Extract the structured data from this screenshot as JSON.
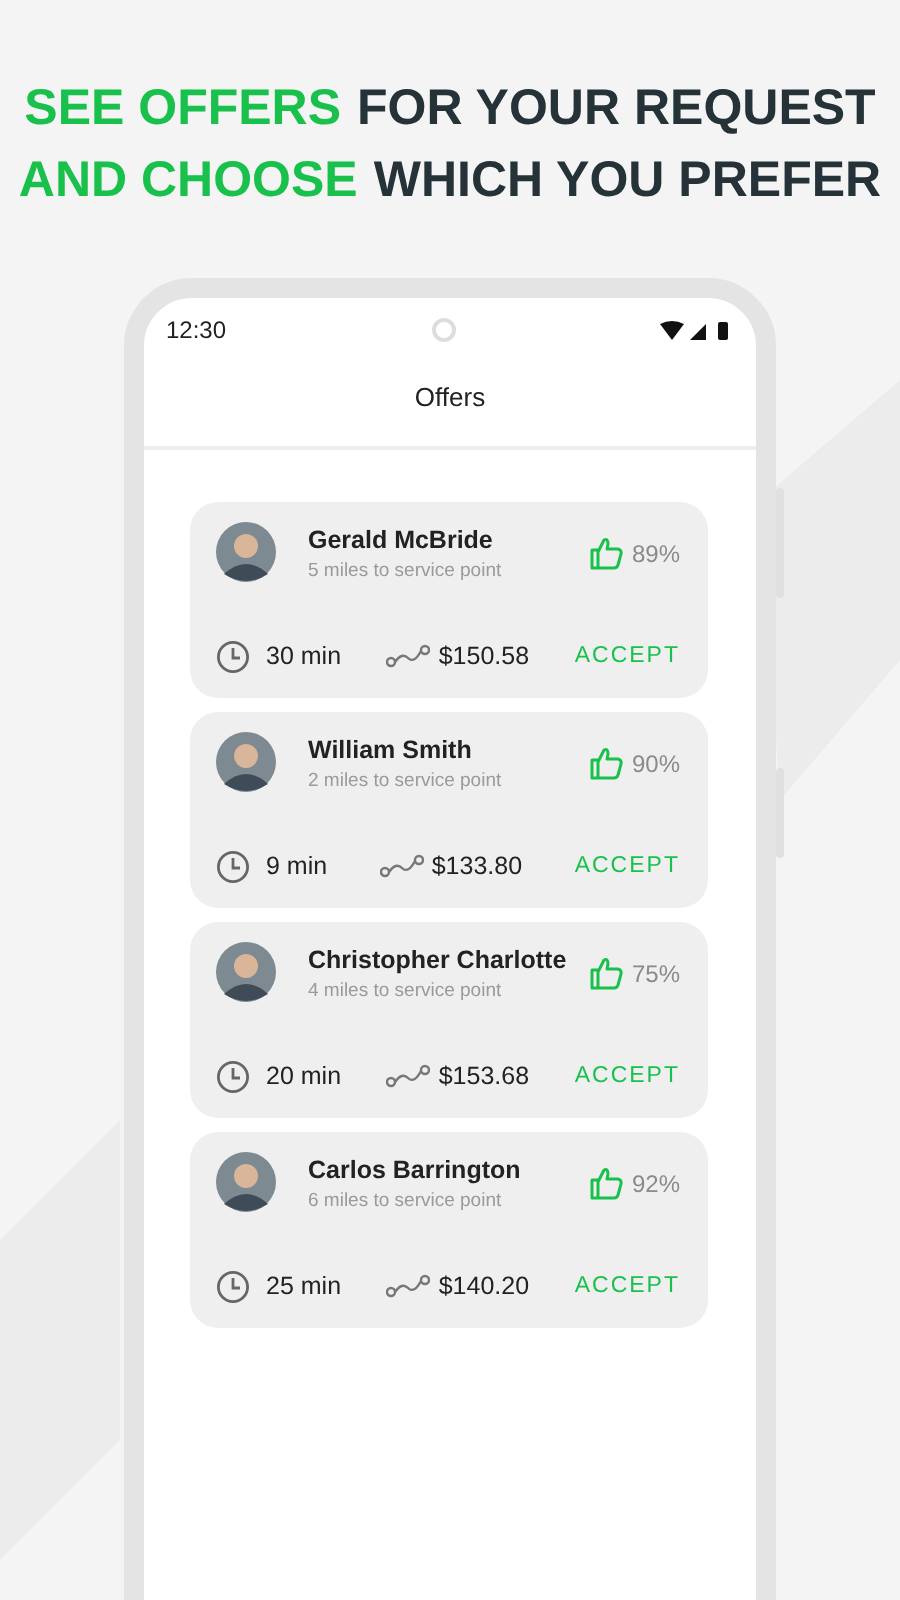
{
  "headline": [
    [
      {
        "text": "SEE OFFERS",
        "highlight": true
      },
      {
        "text": "FOR YOUR REQUEST",
        "highlight": false
      }
    ],
    [
      {
        "text": "AND CHOOSE",
        "highlight": true
      },
      {
        "text": "WHICH YOU PREFER",
        "highlight": false
      }
    ]
  ],
  "status_bar": {
    "time": "12:30"
  },
  "title": "Offers",
  "offers": [
    {
      "name": "Gerald McBride",
      "distance": "5 miles to service point",
      "rating": "89%",
      "time": "30 min",
      "price": "$150.58",
      "action": "ACCEPT"
    },
    {
      "name": "William Smith",
      "distance": "2 miles to service point",
      "rating": "90%",
      "time": "9 min",
      "price": "$133.80",
      "action": "ACCEPT"
    },
    {
      "name": "Christopher Charlotte",
      "distance": "4 miles to service point",
      "rating": "75%",
      "time": "20 min",
      "price": "$153.68",
      "action": "ACCEPT"
    },
    {
      "name": "Carlos Barrington",
      "distance": "6 miles to service point",
      "rating": "92%",
      "time": "25 min",
      "price": "$140.20",
      "action": "ACCEPT"
    }
  ]
}
